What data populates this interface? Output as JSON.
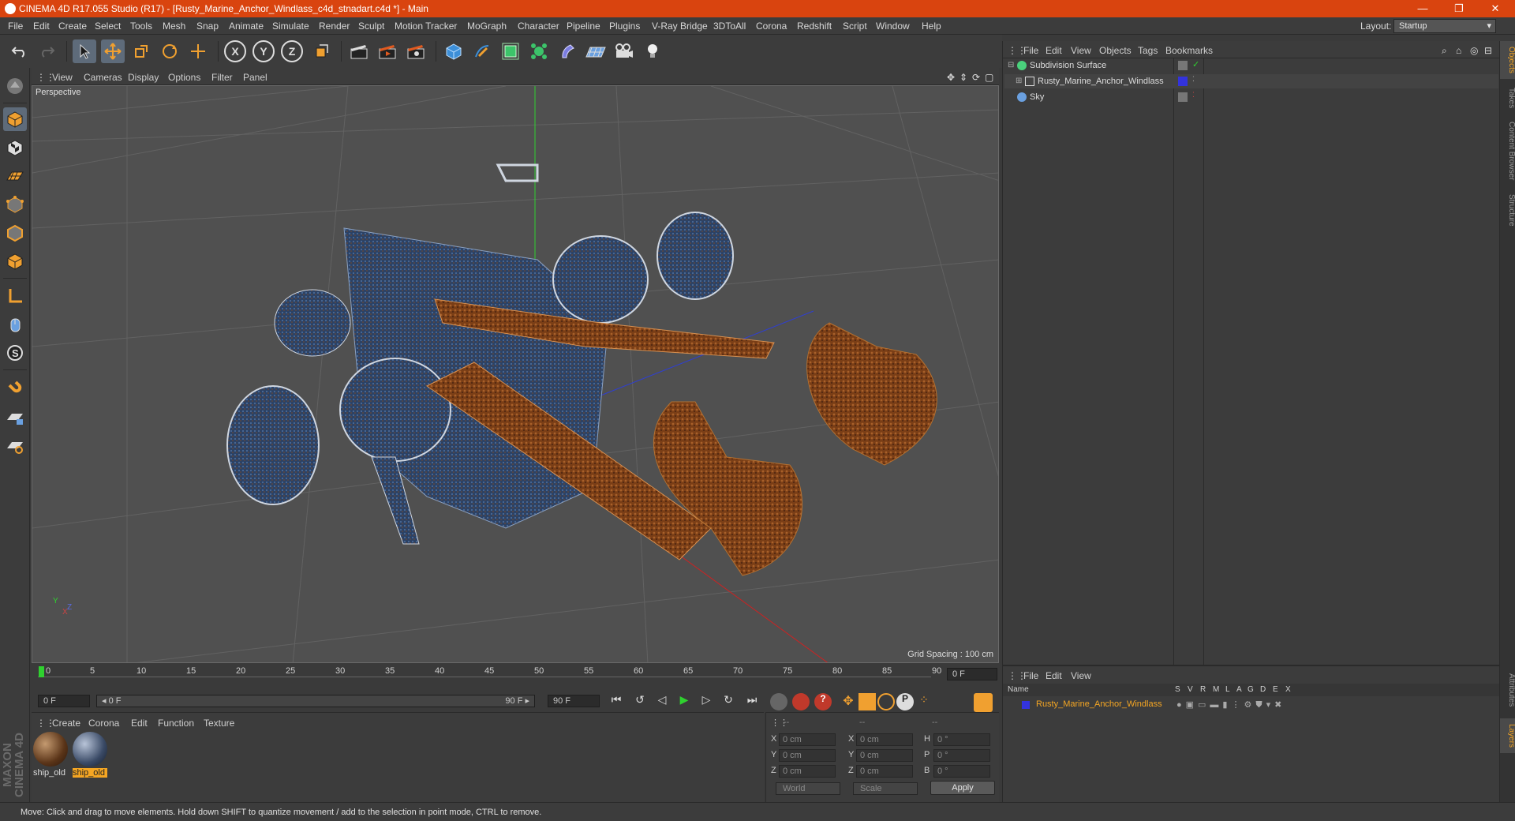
{
  "window": {
    "title": "CINEMA 4D R17.055 Studio (R17) - [Rusty_Marine_Anchor_Windlass_c4d_stnadart.c4d *] - Main",
    "minimize": "—",
    "restore": "❐",
    "close": "✕"
  },
  "menubar": {
    "items": [
      "File",
      "Edit",
      "Create",
      "Select",
      "Tools",
      "Mesh",
      "Snap",
      "Animate",
      "Simulate",
      "Render",
      "Sculpt",
      "Motion Tracker",
      "MoGraph",
      "Character",
      "Pipeline",
      "Plugins",
      "V-Ray Bridge",
      "3DToAll",
      "Corona",
      "Redshift",
      "Script",
      "Window",
      "Help"
    ],
    "layout_label": "Layout:",
    "layout_value": "Startup"
  },
  "toolbar": {
    "undo_icon": "undo-icon",
    "x_axis": "X",
    "y_axis": "Y",
    "z_axis": "Z"
  },
  "viewport": {
    "menu": [
      "View",
      "Cameras",
      "Display",
      "Options",
      "Filter",
      "Panel"
    ],
    "label": "Perspective",
    "grid_spacing": "Grid Spacing : 100 cm",
    "axis_y": "Y",
    "axis_x": "X",
    "axis_z": "Z"
  },
  "timeline": {
    "ticks": [
      "0",
      "5",
      "10",
      "15",
      "20",
      "25",
      "30",
      "35",
      "40",
      "45",
      "50",
      "55",
      "60",
      "65",
      "70",
      "75",
      "80",
      "85",
      "90"
    ],
    "frame_field": "0 F",
    "start_field": "0 F",
    "range_start": "◂ 0 F",
    "range_end": "90 F ▸",
    "end_field": "90 F"
  },
  "materials": {
    "menu": [
      "Create",
      "Corona",
      "Edit",
      "Function",
      "Texture"
    ],
    "items": [
      {
        "label": "ship_old",
        "selected": false
      },
      {
        "label": "ship_old",
        "selected": true
      }
    ]
  },
  "coordinates": {
    "header": [
      "--",
      "--",
      "--"
    ],
    "rows": [
      {
        "a": "X",
        "av": "0 cm",
        "b": "X",
        "bv": "0 cm",
        "c": "H",
        "cv": "0 °"
      },
      {
        "a": "Y",
        "av": "0 cm",
        "b": "Y",
        "bv": "0 cm",
        "c": "P",
        "cv": "0 °"
      },
      {
        "a": "Z",
        "av": "0 cm",
        "b": "Z",
        "bv": "0 cm",
        "c": "B",
        "cv": "0 °"
      }
    ],
    "world": "World",
    "scale": "Scale",
    "apply": "Apply"
  },
  "objects": {
    "menu": [
      "File",
      "Edit",
      "View",
      "Objects",
      "Tags",
      "Bookmarks"
    ],
    "rows": [
      {
        "name": "Subdivision Surface",
        "color": "#4ad17c"
      },
      {
        "name": "Rusty_Marine_Anchor_Windlass",
        "color": "#3333dd"
      },
      {
        "name": "Sky",
        "color": "#6aa0e0"
      }
    ]
  },
  "layers": {
    "menu": [
      "File",
      "Edit",
      "View"
    ],
    "headers": [
      "Name",
      "S",
      "V",
      "R",
      "M",
      "L",
      "A",
      "G",
      "D",
      "E",
      "X"
    ],
    "row_name": "Rusty_Marine_Anchor_Windlass",
    "row_color": "#3333dd"
  },
  "right_tabs": [
    "Objects",
    "Takes",
    "Content Browser",
    "Structure",
    "Attributes",
    "Layers"
  ],
  "status": "Move: Click and drag to move elements. Hold down SHIFT to quantize movement / add to the selection in point mode, CTRL to remove.",
  "logo": {
    "line1": "MAXON",
    "line2": "CINEMA 4D"
  },
  "colors": {
    "accent": "#f5a623",
    "titlebar": "#d9440f",
    "rust": "#8a4a1c",
    "metal": "#2e4466"
  }
}
